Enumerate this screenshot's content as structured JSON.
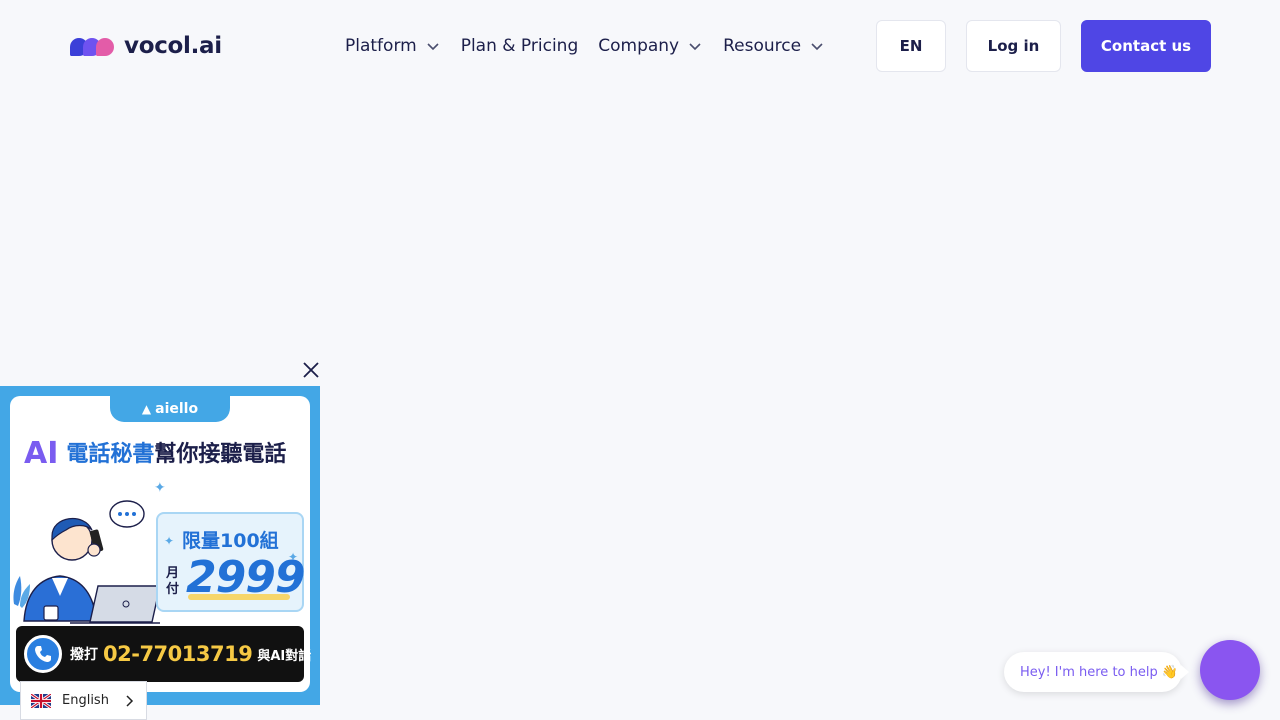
{
  "header": {
    "logo_text": "vocol.ai",
    "nav": [
      {
        "label": "Platform",
        "has_dropdown": true
      },
      {
        "label": "Plan & Pricing",
        "has_dropdown": false
      },
      {
        "label": "Company",
        "has_dropdown": true
      },
      {
        "label": "Resource",
        "has_dropdown": true
      }
    ],
    "lang_button": "EN",
    "login_button": "Log in",
    "contact_button": "Contact us"
  },
  "ad": {
    "close_icon": "close-icon",
    "brand": "aiello",
    "headline_ai": "AI",
    "headline_blue": "電話秘書",
    "headline_dark": "幫你接聽電話",
    "limit_text": "限量100組",
    "monthly_label": "月付",
    "price": "2999",
    "call_prefix": "撥打",
    "phone_number": "02-77013719",
    "call_suffix": "與AI對話",
    "colors": {
      "background": "#43a7e6",
      "accent_blue": "#2271d6",
      "price_yellow": "#f6c944"
    }
  },
  "language_switcher": {
    "label": "English",
    "flag_icon": "uk-flag-icon"
  },
  "chat": {
    "greeting": "Hey! I'm here to help",
    "greeting_emoji": "👋",
    "launcher_color": "#8a55f0"
  },
  "colors": {
    "page_bg": "#f7f8fb",
    "primary": "#4f46e5",
    "text": "#1c1f4a"
  }
}
